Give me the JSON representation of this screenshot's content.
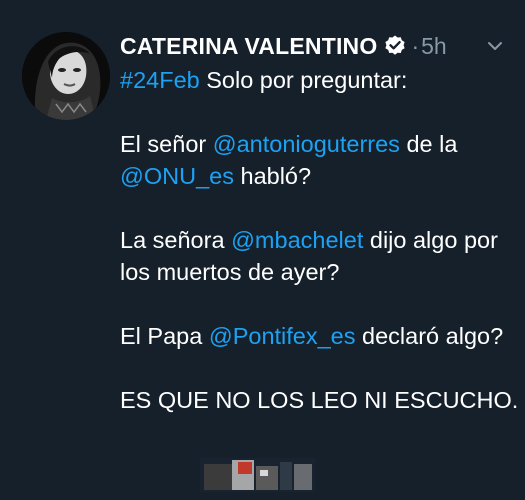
{
  "tweet": {
    "author_name": "CATERINA VALENTINO",
    "separator": "·",
    "time": "5h",
    "text": {
      "hashtag": "#24Feb",
      "line1_rest": " Solo por preguntar:",
      "p2_before": "El señor ",
      "p2_mention1": "@antonioguterres",
      "p2_mid": " de la ",
      "p2_mention2": "@ONU_es",
      "p2_after": " habló?",
      "p3_before": "La señora ",
      "p3_mention": "@mbachelet",
      "p3_after": " dijo algo por los muertos de ayer?",
      "p4_before": "El Papa ",
      "p4_mention": "@Pontifex_es",
      "p4_after": " declaró algo?",
      "p5": "ES QUE NO LOS LEO NI ESCUCHO."
    }
  },
  "icons": {
    "verified": "verified-badge-icon",
    "caret": "chevron-down-icon"
  },
  "colors": {
    "background": "#15202b",
    "text": "#ffffff",
    "link": "#1da1f2",
    "muted": "#8899a6"
  }
}
